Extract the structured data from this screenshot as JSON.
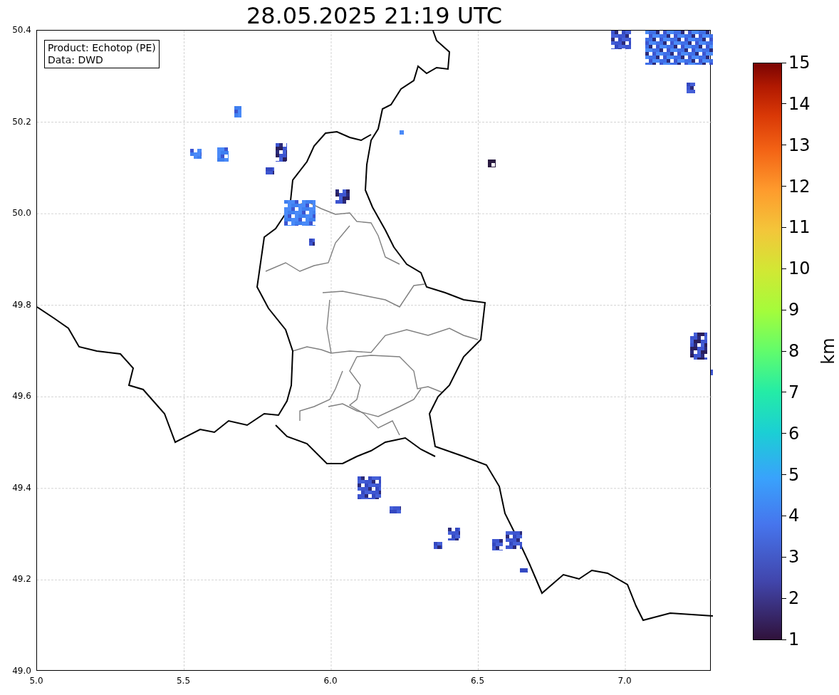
{
  "title": "28.05.2025 21:19 UTC",
  "legend": [
    "Product: Echotop (PE)",
    "Data: DWD"
  ],
  "x_ticks": [
    "5.0",
    "5.5",
    "6.0",
    "6.5",
    "7.0"
  ],
  "y_ticks": [
    "50.4",
    "50.2",
    "50.0",
    "49.8",
    "49.6",
    "49.4",
    "49.2",
    "49.0"
  ],
  "colorbar": {
    "label": "km",
    "ticks": [
      "15",
      "14",
      "13",
      "12",
      "11",
      "10",
      "9",
      "8",
      "7",
      "6",
      "5",
      "4",
      "3",
      "2",
      "1"
    ]
  }
}
